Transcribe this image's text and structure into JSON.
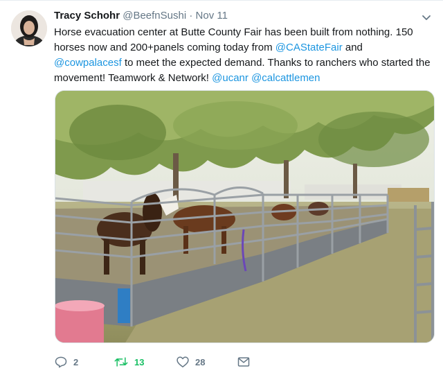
{
  "tweet": {
    "author_name": "Tracy Schohr",
    "handle": "@BeefnSushi",
    "separator": "·",
    "date": "Nov 11",
    "text_parts": [
      "Horse evacuation center at Butte County Fair has been built from nothing. 150 horses now and 200+panels coming today from ",
      "@CAStateFair",
      " and ",
      "@cowpalacesf",
      " to meet the expected demand. Thanks to ranchers who started the movement! Teamwork & Network! ",
      "@ucanr",
      " ",
      "@calcattlemen"
    ]
  },
  "actions": {
    "reply_count": "2",
    "retweet_count": "13",
    "like_count": "28"
  },
  "colors": {
    "link": "#1b95e0",
    "retweet_active": "#17bf63",
    "muted": "#657786",
    "text": "#14171a"
  },
  "icons": [
    "chevron-down-icon",
    "reply-icon",
    "retweet-icon",
    "like-icon",
    "message-icon"
  ]
}
